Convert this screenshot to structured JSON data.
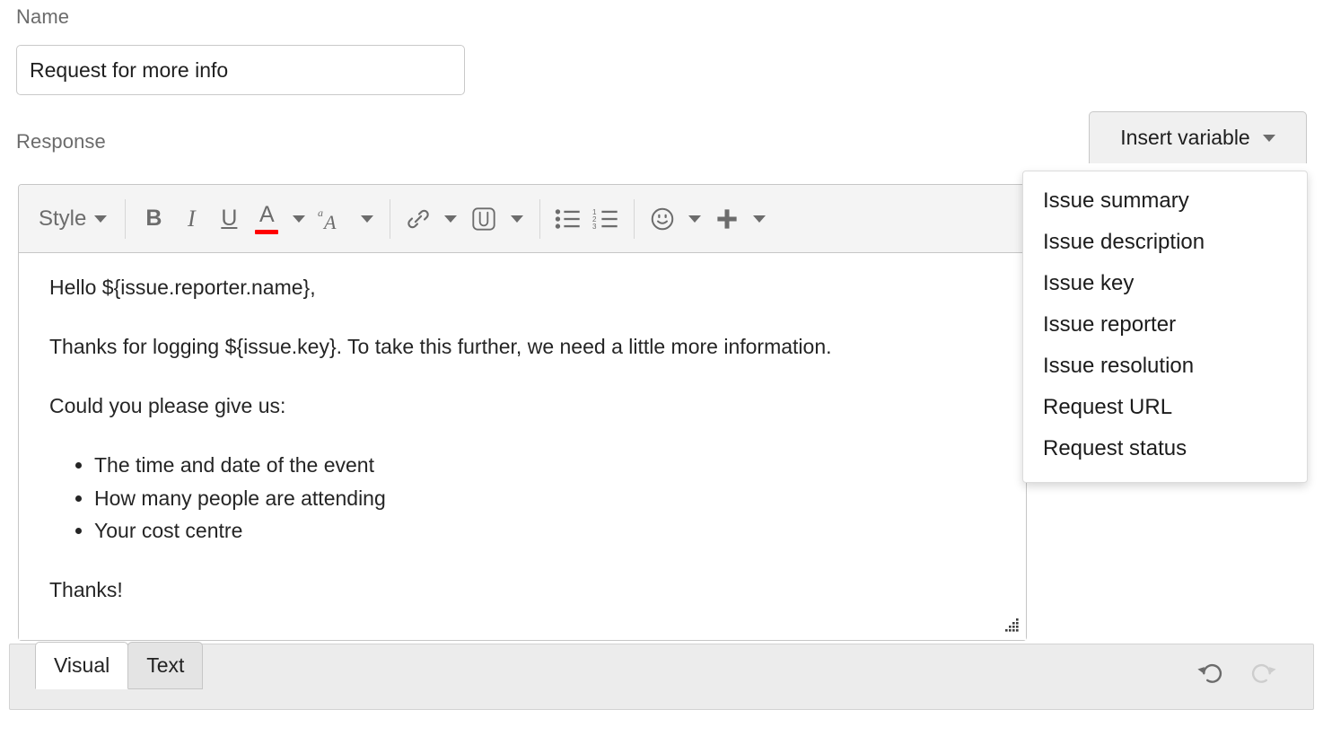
{
  "form": {
    "name_label": "Name",
    "name_value": "Request for more info",
    "name_placeholder": "Name",
    "response_label": "Response"
  },
  "toolbar": {
    "style_label": "Style",
    "bold_label": "B",
    "italic_label": "I",
    "underline_label": "U",
    "text_color_label": "A",
    "text_color_hex": "#ff0000",
    "font_size_label": "A",
    "icons": [
      "style-dropdown-icon",
      "bold-icon",
      "italic-icon",
      "underline-icon",
      "text-color-icon",
      "text-color-dropdown-icon",
      "font-size-icon",
      "font-size-dropdown-icon",
      "link-icon",
      "link-dropdown-icon",
      "attachment-icon",
      "attachment-dropdown-icon",
      "bullet-list-icon",
      "numbered-list-icon",
      "emoji-icon",
      "emoji-dropdown-icon",
      "insert-plus-icon",
      "insert-plus-dropdown-icon"
    ]
  },
  "editor": {
    "greeting": "Hello ${issue.reporter.name},",
    "intro": "Thanks for logging ${issue.key}. To take this further, we need a little more information.",
    "ask": "Could you please give us:",
    "bullets": [
      "The time and date of the event",
      "How many people are attending",
      "Your cost centre"
    ],
    "closing": "Thanks!"
  },
  "bottom_bar": {
    "tabs": [
      {
        "label": "Visual",
        "active": true
      },
      {
        "label": "Text",
        "active": false
      }
    ],
    "undo_label": "Undo",
    "redo_label": "Redo",
    "redo_disabled": true
  },
  "insert_variable": {
    "button_label": "Insert variable",
    "menu_open": true,
    "items": [
      "Issue summary",
      "Issue description",
      "Issue key",
      "Issue reporter",
      "Issue resolution",
      "Request URL",
      "Request status"
    ]
  },
  "colors": {
    "accent_red": "#ff0000",
    "toolbar_bg": "#f4f4f4",
    "bottom_bar_bg": "#ececec",
    "label_gray": "#6b6b6b",
    "text": "#252525"
  }
}
